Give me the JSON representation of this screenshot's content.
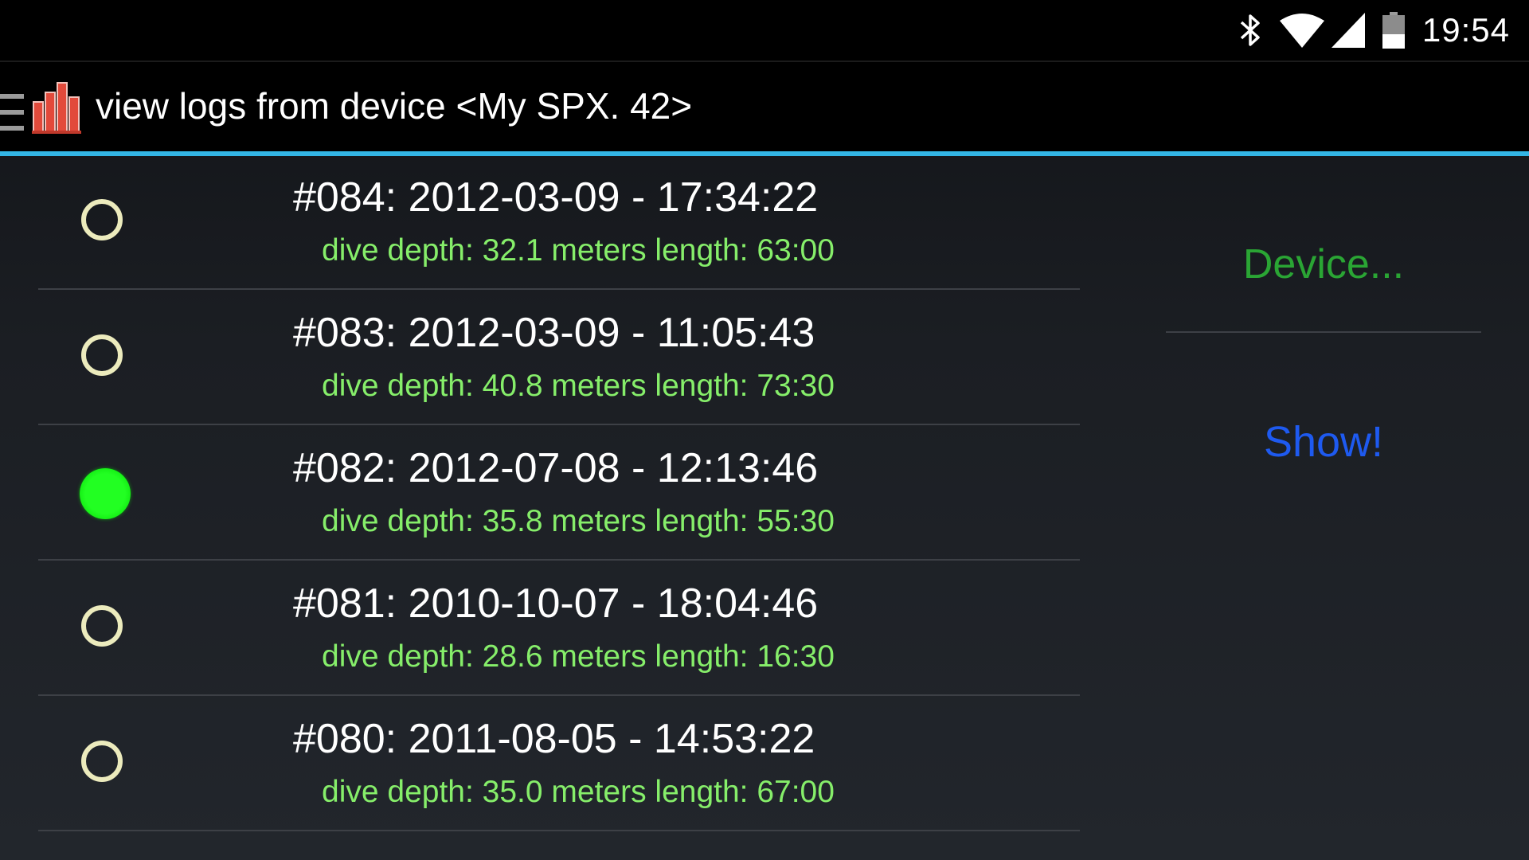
{
  "status_bar": {
    "time": "19:54",
    "icons": [
      "bluetooth-icon",
      "wifi-icon",
      "cell-signal-icon",
      "battery-icon"
    ]
  },
  "action_bar": {
    "title": "view logs from device <My SPX. 42>",
    "app_icon": "bar-chart-icon",
    "accent_color": "#33b5e5"
  },
  "logs": [
    {
      "title": "#084: 2012-03-09 - 17:34:22",
      "detail": "dive depth: 32.1 meters length: 63:00",
      "selected": false
    },
    {
      "title": "#083: 2012-03-09 - 11:05:43",
      "detail": "dive depth: 40.8 meters length: 73:30",
      "selected": false
    },
    {
      "title": "#082: 2012-07-08 - 12:13:46",
      "detail": "dive depth: 35.8 meters length: 55:30",
      "selected": true
    },
    {
      "title": "#081: 2010-10-07 - 18:04:46",
      "detail": "dive depth: 28.6 meters length: 16:30",
      "selected": false
    },
    {
      "title": "#080: 2011-08-05 - 14:53:22",
      "detail": "dive depth: 35.0 meters length: 67:00",
      "selected": false
    }
  ],
  "side_panel": {
    "device_label": "Device...",
    "show_label": "Show!"
  },
  "colors": {
    "detail_text": "#86ee6a",
    "radio_selected": "#22ff22",
    "device_button": "#2aa534",
    "show_button": "#1e5af0"
  }
}
